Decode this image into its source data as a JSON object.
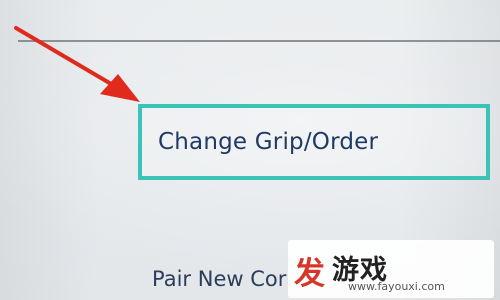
{
  "menu": {
    "items": [
      {
        "label": "Change Grip/Order",
        "selected": true
      },
      {
        "label": "Pair New Cor",
        "selected": false
      }
    ]
  },
  "watermark": {
    "logo_char": "发",
    "name": "游戏",
    "url": "www.fayouxi.com"
  },
  "colors": {
    "selection_border": "#3cc3b8",
    "label_text": "#1f3a63",
    "annotation_arrow": "#e02a1c",
    "background": "#e7eaed"
  },
  "annotation": {
    "icon": "red-arrow-icon"
  }
}
